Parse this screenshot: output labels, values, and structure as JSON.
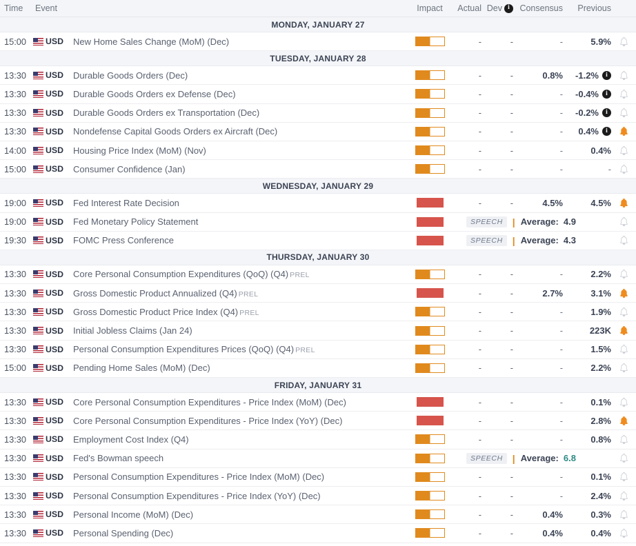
{
  "header": {
    "time": "Time",
    "event": "Event",
    "impact": "Impact",
    "actual": "Actual",
    "dev": "Dev",
    "dev_info_icon": "info-icon",
    "consensus": "Consensus",
    "previous": "Previous"
  },
  "colors": {
    "impact_medium": "#e08a1e",
    "impact_high": "#d6544b",
    "bell_active": "#ef8c20",
    "bell_inactive": "#c8ccd3",
    "green_value": "#2e8b84",
    "day_header_bg": "#f4f5f8",
    "row_border": "#ededf1"
  },
  "days": [
    {
      "label": "MONDAY, JANUARY 27",
      "rows": [
        {
          "time": "15:00",
          "flag": "us-flag-icon",
          "currency": "USD",
          "event": "New Home Sales Change (MoM) (Dec)",
          "suffix": "",
          "impact": "medium",
          "actual": "-",
          "dev": "-",
          "consensus": "-",
          "previous": "5.9%",
          "info": false,
          "alert": "inactive",
          "type": "data"
        }
      ]
    },
    {
      "label": "TUESDAY, JANUARY 28",
      "rows": [
        {
          "time": "13:30",
          "flag": "us-flag-icon",
          "currency": "USD",
          "event": "Durable Goods Orders (Dec)",
          "suffix": "",
          "impact": "medium",
          "actual": "-",
          "dev": "-",
          "consensus": "0.8%",
          "previous": "-1.2%",
          "info": true,
          "alert": "inactive",
          "type": "data"
        },
        {
          "time": "13:30",
          "flag": "us-flag-icon",
          "currency": "USD",
          "event": "Durable Goods Orders ex Defense (Dec)",
          "suffix": "",
          "impact": "medium",
          "actual": "-",
          "dev": "-",
          "consensus": "-",
          "previous": "-0.4%",
          "info": true,
          "alert": "inactive",
          "type": "data"
        },
        {
          "time": "13:30",
          "flag": "us-flag-icon",
          "currency": "USD",
          "event": "Durable Goods Orders ex Transportation (Dec)",
          "suffix": "",
          "impact": "medium",
          "actual": "-",
          "dev": "-",
          "consensus": "-",
          "previous": "-0.2%",
          "info": true,
          "alert": "inactive",
          "type": "data"
        },
        {
          "time": "13:30",
          "flag": "us-flag-icon",
          "currency": "USD",
          "event": "Nondefense Capital Goods Orders ex Aircraft (Dec)",
          "suffix": "",
          "impact": "medium",
          "actual": "-",
          "dev": "-",
          "consensus": "-",
          "previous": "0.4%",
          "info": true,
          "alert": "active",
          "type": "data"
        },
        {
          "time": "14:00",
          "flag": "us-flag-icon",
          "currency": "USD",
          "event": "Housing Price Index (MoM) (Nov)",
          "suffix": "",
          "impact": "medium",
          "actual": "-",
          "dev": "-",
          "consensus": "-",
          "previous": "0.4%",
          "info": false,
          "alert": "inactive",
          "type": "data"
        },
        {
          "time": "15:00",
          "flag": "us-flag-icon",
          "currency": "USD",
          "event": "Consumer Confidence (Jan)",
          "suffix": "",
          "impact": "medium",
          "actual": "-",
          "dev": "-",
          "consensus": "-",
          "previous": "-",
          "info": false,
          "alert": "inactive",
          "type": "data"
        }
      ]
    },
    {
      "label": "WEDNESDAY, JANUARY 29",
      "rows": [
        {
          "time": "19:00",
          "flag": "us-flag-icon",
          "currency": "USD",
          "event": "Fed Interest Rate Decision",
          "suffix": "",
          "impact": "high",
          "actual": "-",
          "dev": "-",
          "consensus": "4.5%",
          "previous": "4.5%",
          "info": false,
          "alert": "active",
          "type": "data"
        },
        {
          "time": "19:00",
          "flag": "us-flag-icon",
          "currency": "USD",
          "event": "Fed Monetary Policy Statement",
          "suffix": "",
          "impact": "high",
          "speech_badge": "SPEECH",
          "average_label": "Average:",
          "average_value": "4.9",
          "average_green": false,
          "alert": "inactive",
          "type": "speech"
        },
        {
          "time": "19:30",
          "flag": "us-flag-icon",
          "currency": "USD",
          "event": "FOMC Press Conference",
          "suffix": "",
          "impact": "high",
          "speech_badge": "SPEECH",
          "average_label": "Average:",
          "average_value": "4.3",
          "average_green": false,
          "alert": "inactive",
          "type": "speech"
        }
      ]
    },
    {
      "label": "THURSDAY, JANUARY 30",
      "rows": [
        {
          "time": "13:30",
          "flag": "us-flag-icon",
          "currency": "USD",
          "event": "Core Personal Consumption Expenditures (QoQ) (Q4)",
          "suffix": "PREL",
          "impact": "medium",
          "actual": "-",
          "dev": "-",
          "consensus": "-",
          "previous": "2.2%",
          "info": false,
          "alert": "inactive",
          "type": "data"
        },
        {
          "time": "13:30",
          "flag": "us-flag-icon",
          "currency": "USD",
          "event": "Gross Domestic Product Annualized (Q4)",
          "suffix": "PREL",
          "impact": "high",
          "actual": "-",
          "dev": "-",
          "consensus": "2.7%",
          "previous": "3.1%",
          "info": false,
          "alert": "active",
          "type": "data"
        },
        {
          "time": "13:30",
          "flag": "us-flag-icon",
          "currency": "USD",
          "event": "Gross Domestic Product Price Index (Q4)",
          "suffix": "PREL",
          "impact": "medium",
          "actual": "-",
          "dev": "-",
          "consensus": "-",
          "previous": "1.9%",
          "info": false,
          "alert": "inactive",
          "type": "data"
        },
        {
          "time": "13:30",
          "flag": "us-flag-icon",
          "currency": "USD",
          "event": "Initial Jobless Claims (Jan 24)",
          "suffix": "",
          "impact": "medium",
          "actual": "-",
          "dev": "-",
          "consensus": "-",
          "previous": "223K",
          "info": false,
          "alert": "active",
          "type": "data"
        },
        {
          "time": "13:30",
          "flag": "us-flag-icon",
          "currency": "USD",
          "event": "Personal Consumption Expenditures Prices (QoQ) (Q4)",
          "suffix": "PREL",
          "impact": "medium",
          "actual": "-",
          "dev": "-",
          "consensus": "-",
          "previous": "1.5%",
          "info": false,
          "alert": "inactive",
          "type": "data"
        },
        {
          "time": "15:00",
          "flag": "us-flag-icon",
          "currency": "USD",
          "event": "Pending Home Sales (MoM) (Dec)",
          "suffix": "",
          "impact": "medium",
          "actual": "-",
          "dev": "-",
          "consensus": "-",
          "previous": "2.2%",
          "info": false,
          "alert": "inactive",
          "type": "data"
        }
      ]
    },
    {
      "label": "FRIDAY, JANUARY 31",
      "rows": [
        {
          "time": "13:30",
          "flag": "us-flag-icon",
          "currency": "USD",
          "event": "Core Personal Consumption Expenditures - Price Index (MoM) (Dec)",
          "suffix": "",
          "impact": "high",
          "actual": "-",
          "dev": "-",
          "consensus": "-",
          "previous": "0.1%",
          "info": false,
          "alert": "inactive",
          "type": "data"
        },
        {
          "time": "13:30",
          "flag": "us-flag-icon",
          "currency": "USD",
          "event": "Core Personal Consumption Expenditures - Price Index (YoY) (Dec)",
          "suffix": "",
          "impact": "high",
          "actual": "-",
          "dev": "-",
          "consensus": "-",
          "previous": "2.8%",
          "info": false,
          "alert": "active",
          "type": "data"
        },
        {
          "time": "13:30",
          "flag": "us-flag-icon",
          "currency": "USD",
          "event": "Employment Cost Index (Q4)",
          "suffix": "",
          "impact": "medium",
          "actual": "-",
          "dev": "-",
          "consensus": "-",
          "previous": "0.8%",
          "info": false,
          "alert": "inactive",
          "type": "data"
        },
        {
          "time": "13:30",
          "flag": "us-flag-icon",
          "currency": "USD",
          "event": "Fed's Bowman speech",
          "suffix": "",
          "impact": "medium",
          "speech_badge": "SPEECH",
          "average_label": "Average:",
          "average_value": "6.8",
          "average_green": true,
          "alert": "inactive",
          "type": "speech"
        },
        {
          "time": "13:30",
          "flag": "us-flag-icon",
          "currency": "USD",
          "event": "Personal Consumption Expenditures - Price Index (MoM) (Dec)",
          "suffix": "",
          "impact": "medium",
          "actual": "-",
          "dev": "-",
          "consensus": "-",
          "previous": "0.1%",
          "info": false,
          "alert": "inactive",
          "type": "data"
        },
        {
          "time": "13:30",
          "flag": "us-flag-icon",
          "currency": "USD",
          "event": "Personal Consumption Expenditures - Price Index (YoY) (Dec)",
          "suffix": "",
          "impact": "medium",
          "actual": "-",
          "dev": "-",
          "consensus": "-",
          "previous": "2.4%",
          "info": false,
          "alert": "inactive",
          "type": "data"
        },
        {
          "time": "13:30",
          "flag": "us-flag-icon",
          "currency": "USD",
          "event": "Personal Income (MoM) (Dec)",
          "suffix": "",
          "impact": "medium",
          "actual": "-",
          "dev": "-",
          "consensus": "0.4%",
          "previous": "0.3%",
          "info": false,
          "alert": "inactive",
          "type": "data"
        },
        {
          "time": "13:30",
          "flag": "us-flag-icon",
          "currency": "USD",
          "event": "Personal Spending (Dec)",
          "suffix": "",
          "impact": "medium",
          "actual": "-",
          "dev": "-",
          "consensus": "0.4%",
          "previous": "0.4%",
          "info": false,
          "alert": "inactive",
          "type": "data"
        }
      ]
    }
  ]
}
